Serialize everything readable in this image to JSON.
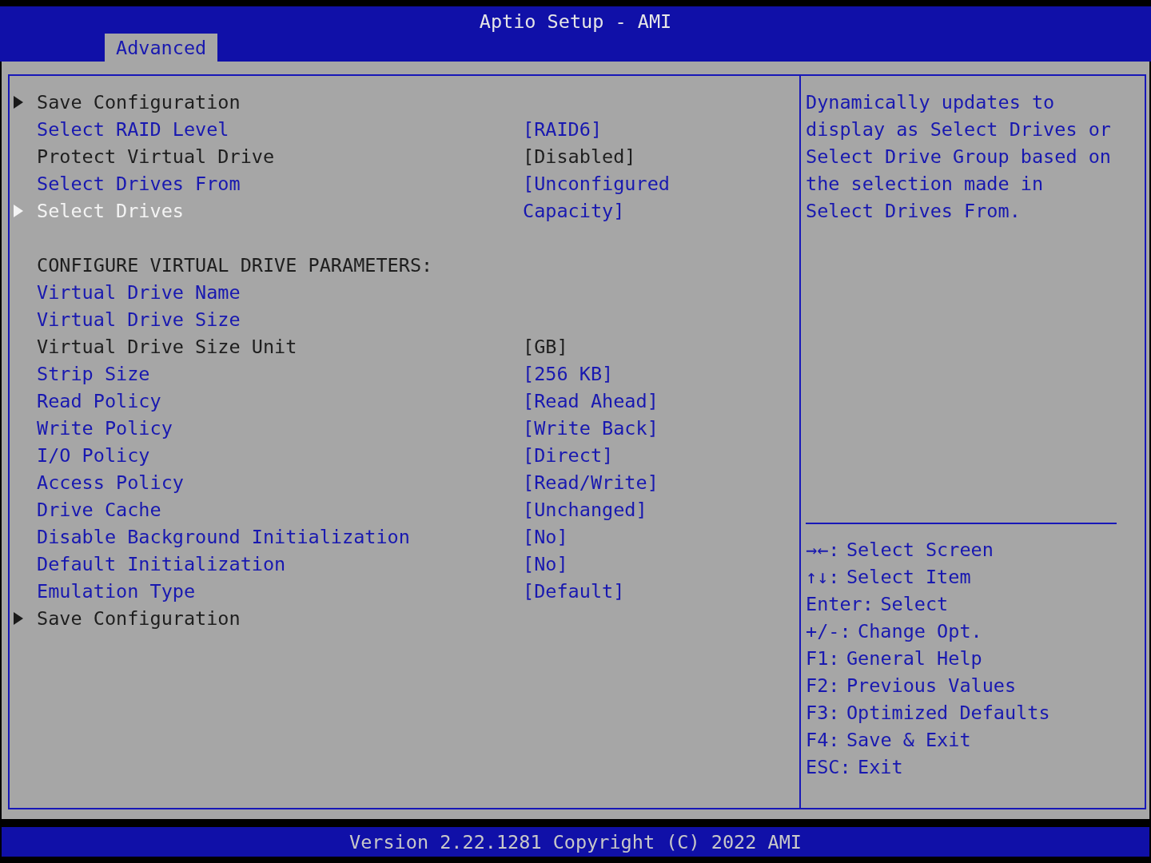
{
  "window": {
    "title": "Aptio Setup - AMI"
  },
  "tabs": [
    {
      "label": "Advanced",
      "selected": true
    }
  ],
  "items": [
    {
      "kind": "submenu",
      "label": "Save Configuration",
      "editable": false,
      "selected": false
    },
    {
      "kind": "option",
      "label": "Select RAID Level",
      "value": "[RAID6]",
      "editable": true,
      "selected": false
    },
    {
      "kind": "option",
      "label": "Protect Virtual Drive",
      "value": "[Disabled]",
      "editable": false,
      "selected": false
    },
    {
      "kind": "option",
      "label": "Select Drives From",
      "value": "[Unconfigured Capacity]",
      "editable": true,
      "selected": false
    },
    {
      "kind": "submenu",
      "label": "Select Drives",
      "editable": false,
      "selected": true
    },
    {
      "kind": "heading",
      "label": "CONFIGURE VIRTUAL DRIVE PARAMETERS:",
      "editable": false,
      "selected": false
    },
    {
      "kind": "option",
      "label": "Virtual Drive Name",
      "editable": true,
      "selected": false
    },
    {
      "kind": "option",
      "label": "Virtual Drive Size",
      "editable": true,
      "selected": false
    },
    {
      "kind": "option",
      "label": "Virtual Drive Size Unit",
      "value": "[GB]",
      "editable": false,
      "selected": false
    },
    {
      "kind": "option",
      "label": "Strip Size",
      "value": "[256 KB]",
      "editable": true,
      "selected": false
    },
    {
      "kind": "option",
      "label": "Read Policy",
      "value": "[Read Ahead]",
      "editable": true,
      "selected": false
    },
    {
      "kind": "option",
      "label": "Write Policy",
      "value": "[Write Back]",
      "editable": true,
      "selected": false
    },
    {
      "kind": "option",
      "label": "I/O Policy",
      "value": "[Direct]",
      "editable": true,
      "selected": false
    },
    {
      "kind": "option",
      "label": "Access Policy",
      "value": "[Read/Write]",
      "editable": true,
      "selected": false
    },
    {
      "kind": "option",
      "label": "Drive Cache",
      "value": "[Unchanged]",
      "editable": true,
      "selected": false
    },
    {
      "kind": "option",
      "label": "Disable Background Initialization",
      "value": "[No]",
      "editable": true,
      "selected": false
    },
    {
      "kind": "option",
      "label": "Default Initialization",
      "value": "[No]",
      "editable": true,
      "selected": false
    },
    {
      "kind": "option",
      "label": "Emulation Type",
      "value": "[Default]",
      "editable": true,
      "selected": false
    },
    {
      "kind": "submenu",
      "label": "Save Configuration",
      "editable": false,
      "selected": false
    }
  ],
  "help": {
    "text": "Dynamically updates to display as Select Drives or Select Drive Group based on the selection made in Select Drives From.",
    "keys": [
      {
        "key": "→←:",
        "action": "Select Screen"
      },
      {
        "key": "↑↓:",
        "action": "Select Item"
      },
      {
        "key": "Enter:",
        "action": "Select"
      },
      {
        "key": "+/-:",
        "action": "Change Opt."
      },
      {
        "key": "F1:",
        "action": "General Help"
      },
      {
        "key": "F2:",
        "action": "Previous Values"
      },
      {
        "key": "F3:",
        "action": "Optimized Defaults"
      },
      {
        "key": "F4:",
        "action": "Save & Exit"
      },
      {
        "key": "ESC:",
        "action": "Exit"
      }
    ]
  },
  "status_bar": {
    "text": "Version 2.22.1281 Copyright (C) 2022 AMI"
  }
}
